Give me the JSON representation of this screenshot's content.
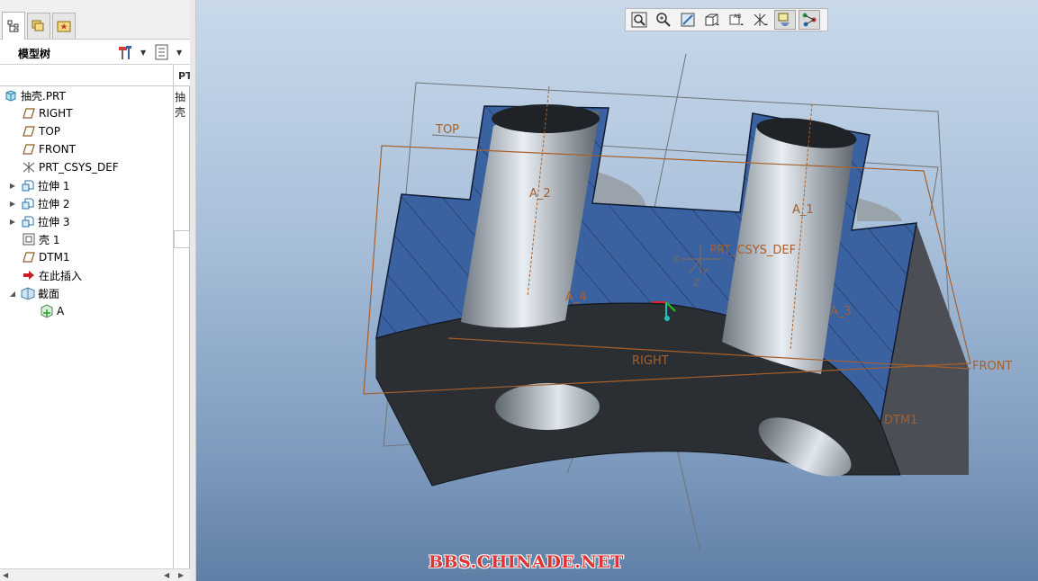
{
  "model_tree": {
    "title": "模型树",
    "column_header": "PT",
    "column_value": "抽壳",
    "items": [
      {
        "label": "抽壳.PRT",
        "icon": "part-icon"
      },
      {
        "label": "RIGHT",
        "icon": "datum-plane-icon"
      },
      {
        "label": "TOP",
        "icon": "datum-plane-icon"
      },
      {
        "label": "FRONT",
        "icon": "datum-plane-icon"
      },
      {
        "label": "PRT_CSYS_DEF",
        "icon": "csys-icon"
      },
      {
        "label": "拉伸 1",
        "icon": "extrude-icon"
      },
      {
        "label": "拉伸 2",
        "icon": "extrude-icon"
      },
      {
        "label": "拉伸 3",
        "icon": "extrude-icon"
      },
      {
        "label": "壳 1",
        "icon": "shell-icon"
      },
      {
        "label": "DTM1",
        "icon": "datum-plane-icon"
      },
      {
        "label": "在此插入",
        "icon": "insert-arrow-icon"
      },
      {
        "label": "截面",
        "icon": "section-folder-icon"
      },
      {
        "label": "A",
        "icon": "section-icon"
      }
    ]
  },
  "viewport": {
    "datum_labels": {
      "top": "TOP",
      "right": "RIGHT",
      "front": "FRONT",
      "dtm1": "DTM1",
      "csys": "PRT_CSYS_DEF",
      "axis_a2": "A_2",
      "axis_a1": "A_1",
      "axis_a4": "A_4",
      "axis_a3": "A_3",
      "csys_x": "X",
      "csys_y": "Y",
      "csys_z": "Z"
    },
    "watermark": "BBS.CHINADE.NET",
    "colors": {
      "section_fill": "#3b62a0",
      "body_dark": "#2b2e33",
      "datum_orange": "#a8602a",
      "datum_gray": "#6f7478",
      "watermark_red": "#e03535"
    }
  },
  "view_toolbar": {
    "buttons": [
      "zoom-fit-icon",
      "zoom-in-icon",
      "refit-icon",
      "display-style-icon",
      "named-views-icon",
      "datum-display-icon",
      "annotation-display-icon",
      "spin-center-icon"
    ]
  }
}
